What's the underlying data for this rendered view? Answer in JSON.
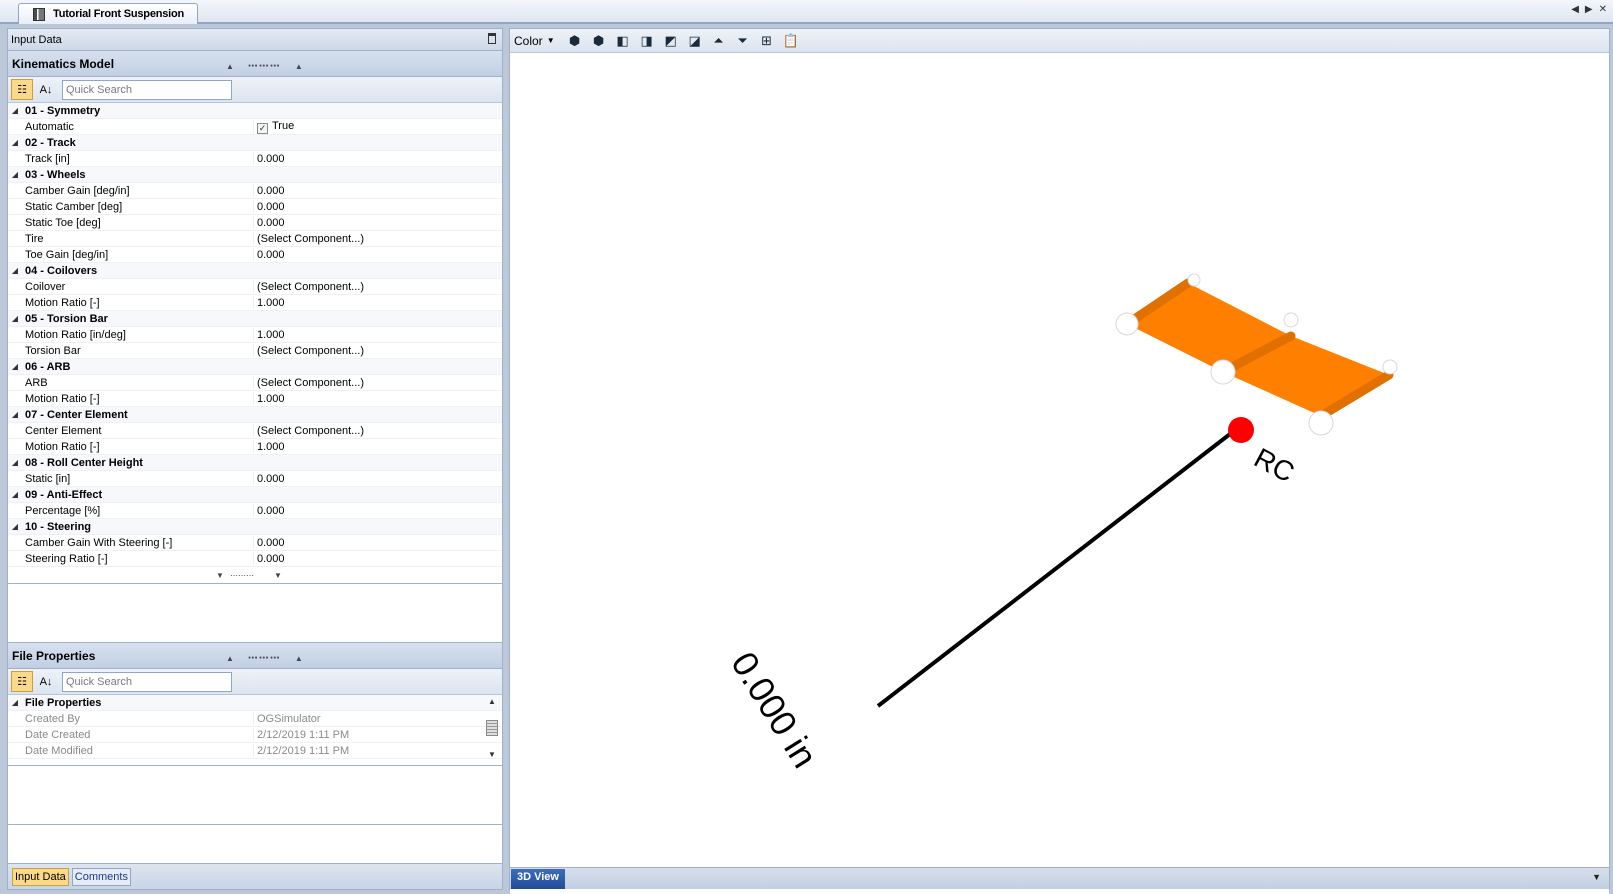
{
  "window": {
    "tab_title": "Tutorial Front Suspension",
    "controls": [
      "◀",
      "▶",
      "✕"
    ]
  },
  "left": {
    "panel_title": "Input Data",
    "kinematics": {
      "title": "Kinematics Model",
      "search_placeholder": "Quick Search",
      "rows": [
        {
          "type": "cat",
          "name": "01 - Symmetry"
        },
        {
          "type": "prop",
          "name": "Automatic",
          "value": "True",
          "checkbox": true
        },
        {
          "type": "cat",
          "name": "02 - Track"
        },
        {
          "type": "prop",
          "name": "Track [in]",
          "value": "0.000"
        },
        {
          "type": "cat",
          "name": "03 - Wheels"
        },
        {
          "type": "prop",
          "name": "Camber Gain [deg/in]",
          "value": "0.000"
        },
        {
          "type": "prop",
          "name": "Static Camber [deg]",
          "value": "0.000"
        },
        {
          "type": "prop",
          "name": "Static Toe [deg]",
          "value": "0.000"
        },
        {
          "type": "prop",
          "name": "Tire",
          "value": "(Select Component...)"
        },
        {
          "type": "prop",
          "name": "Toe Gain [deg/in]",
          "value": "0.000"
        },
        {
          "type": "cat",
          "name": "04 - Coilovers"
        },
        {
          "type": "prop",
          "name": "Coilover",
          "value": "(Select Component...)"
        },
        {
          "type": "prop",
          "name": "Motion Ratio [-]",
          "value": "1.000"
        },
        {
          "type": "cat",
          "name": "05 - Torsion Bar"
        },
        {
          "type": "prop",
          "name": "Motion Ratio [in/deg]",
          "value": "1.000"
        },
        {
          "type": "prop",
          "name": "Torsion Bar",
          "value": "(Select Component...)"
        },
        {
          "type": "cat",
          "name": "06 - ARB"
        },
        {
          "type": "prop",
          "name": "ARB",
          "value": "(Select Component...)"
        },
        {
          "type": "prop",
          "name": "Motion Ratio [-]",
          "value": "1.000"
        },
        {
          "type": "cat",
          "name": "07 - Center Element"
        },
        {
          "type": "prop",
          "name": "Center Element",
          "value": "(Select Component...)"
        },
        {
          "type": "prop",
          "name": "Motion Ratio [-]",
          "value": "1.000"
        },
        {
          "type": "cat",
          "name": "08 - Roll Center Height"
        },
        {
          "type": "prop",
          "name": "Static [in]",
          "value": "0.000"
        },
        {
          "type": "cat",
          "name": "09 - Anti-Effect"
        },
        {
          "type": "prop",
          "name": "Percentage [%]",
          "value": "0.000"
        },
        {
          "type": "cat",
          "name": "10 - Steering"
        },
        {
          "type": "prop",
          "name": "Camber Gain With Steering [-]",
          "value": "0.000"
        },
        {
          "type": "prop",
          "name": "Steering Ratio [-]",
          "value": "0.000"
        }
      ]
    },
    "file_properties": {
      "title": "File Properties",
      "search_placeholder": "Quick Search",
      "rows": [
        {
          "type": "cat",
          "name": "File Properties"
        },
        {
          "type": "prop",
          "name": "Created By",
          "value": "OGSimulator",
          "muted": true
        },
        {
          "type": "prop",
          "name": "Date Created",
          "value": "2/12/2019 1:11 PM",
          "muted": true
        },
        {
          "type": "prop",
          "name": "Date Modified",
          "value": "2/12/2019 1:11 PM",
          "muted": true
        }
      ]
    },
    "bottom_tabs": [
      {
        "label": "Input Data",
        "active": true
      },
      {
        "label": "Comments",
        "active": false
      }
    ]
  },
  "view": {
    "color_label": "Color",
    "tab_label": "3D View",
    "rc_label": "RC",
    "dimension_label": "0.000 in",
    "colors": {
      "arm": "#ff8000",
      "rc_point": "#ff0000",
      "joint": "#ffffff"
    }
  }
}
